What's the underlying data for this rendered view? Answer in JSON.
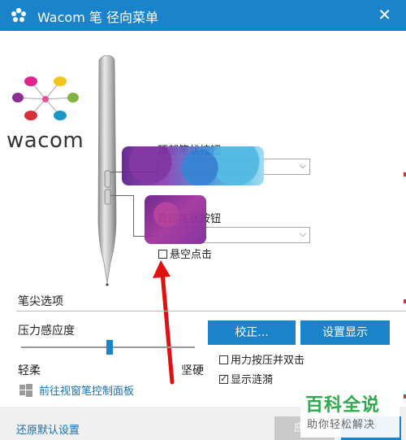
{
  "window": {
    "title": "Wacom 笔  径向菜单",
    "close_glyph": "✕"
  },
  "logo": {
    "wordmark": "wacom"
  },
  "pen_buttons": {
    "upper_label": "顶部笔状按钮",
    "lower_label": "底部笔状按钮",
    "hover_click_label": "悬空点击",
    "hover_click_checked": false
  },
  "tip": {
    "section_title": "笔尖选项",
    "pressure_title": "压力感应度",
    "soft_label": "轻柔",
    "firm_label": "坚硬",
    "pressure_level": 0.5,
    "calibrate_button": "校正...",
    "settings_display_button": "设置显示",
    "double_click_option": "用力按压并双击",
    "double_click_checked": false,
    "show_ripple_option": "显示涟漪",
    "show_ripple_checked": true
  },
  "links": {
    "control_panel": "前往视窗笔控制面板"
  },
  "footer": {
    "reset_label": "还原默认设置",
    "apply_label": "应用"
  },
  "watermark": {
    "main": "百科全说",
    "sub": "助你轻松解决"
  },
  "colors": {
    "accent": "#1a83c9",
    "link": "#1a6fb0",
    "arrow": "#e01010",
    "watermark_green": "#2fa84f"
  },
  "icons": {
    "app": "wacom-app-icon",
    "close": "close-icon",
    "dropdown": "chevron-down-icon",
    "windows": "windows-icon"
  }
}
